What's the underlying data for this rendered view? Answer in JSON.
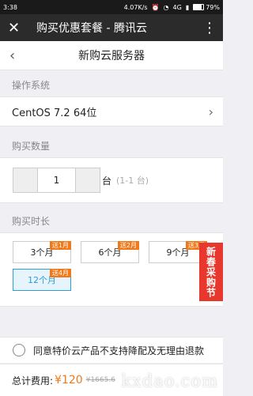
{
  "status": {
    "time": "3:38",
    "speed": "4.07K/s",
    "network": "4G",
    "battery": "79%",
    "battery_level": 0.79
  },
  "wechat_bar": {
    "title": "购买优惠套餐 - 腾讯云"
  },
  "header": {
    "title": "新购云服务器"
  },
  "os": {
    "label": "操作系统",
    "value": "CentOS 7.2 64位"
  },
  "quantity": {
    "label": "购买数量",
    "value": "1",
    "unit": "台",
    "range": "(1-1 台)"
  },
  "duration": {
    "label": "购买时长",
    "options": [
      {
        "label": "3个月",
        "badge": "送1月"
      },
      {
        "label": "6个月",
        "badge": "送2月"
      },
      {
        "label": "9个月",
        "badge": "送3月"
      },
      {
        "label": "12个月",
        "badge": "送4月"
      }
    ]
  },
  "promo": {
    "text": "新春采购节"
  },
  "agreement": {
    "text": "同意特价云产品不支持降配及无理由退款"
  },
  "footer": {
    "total_label": "总计费用:",
    "total_price": "¥120",
    "original_price": "¥1665.6"
  },
  "watermark": "kxdao.com"
}
